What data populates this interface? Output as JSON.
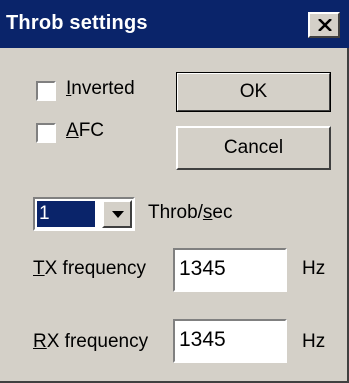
{
  "window": {
    "title": "Throb settings"
  },
  "options": {
    "inverted": {
      "label": "Inverted",
      "mnemonic": "I",
      "rest": "nverted",
      "checked": false
    },
    "afc": {
      "label": "AFC",
      "mnemonic": "A",
      "rest": "FC",
      "checked": false
    }
  },
  "buttons": {
    "ok": "OK",
    "cancel": "Cancel"
  },
  "throb_rate": {
    "value": "1",
    "label": "Throb/sec",
    "label_pre": "Throb/",
    "mnemonic": "s",
    "label_post": "ec"
  },
  "tx": {
    "label": "TX frequency",
    "mnemonic": "T",
    "rest": "X frequency",
    "value": "1345",
    "unit": "Hz"
  },
  "rx": {
    "label": "RX frequency",
    "mnemonic": "R",
    "rest": "X frequency",
    "value": "1345",
    "unit": "Hz"
  },
  "colors": {
    "titlebar": "#0a246a",
    "face": "#d4d0c8",
    "selection": "#0a246a"
  }
}
